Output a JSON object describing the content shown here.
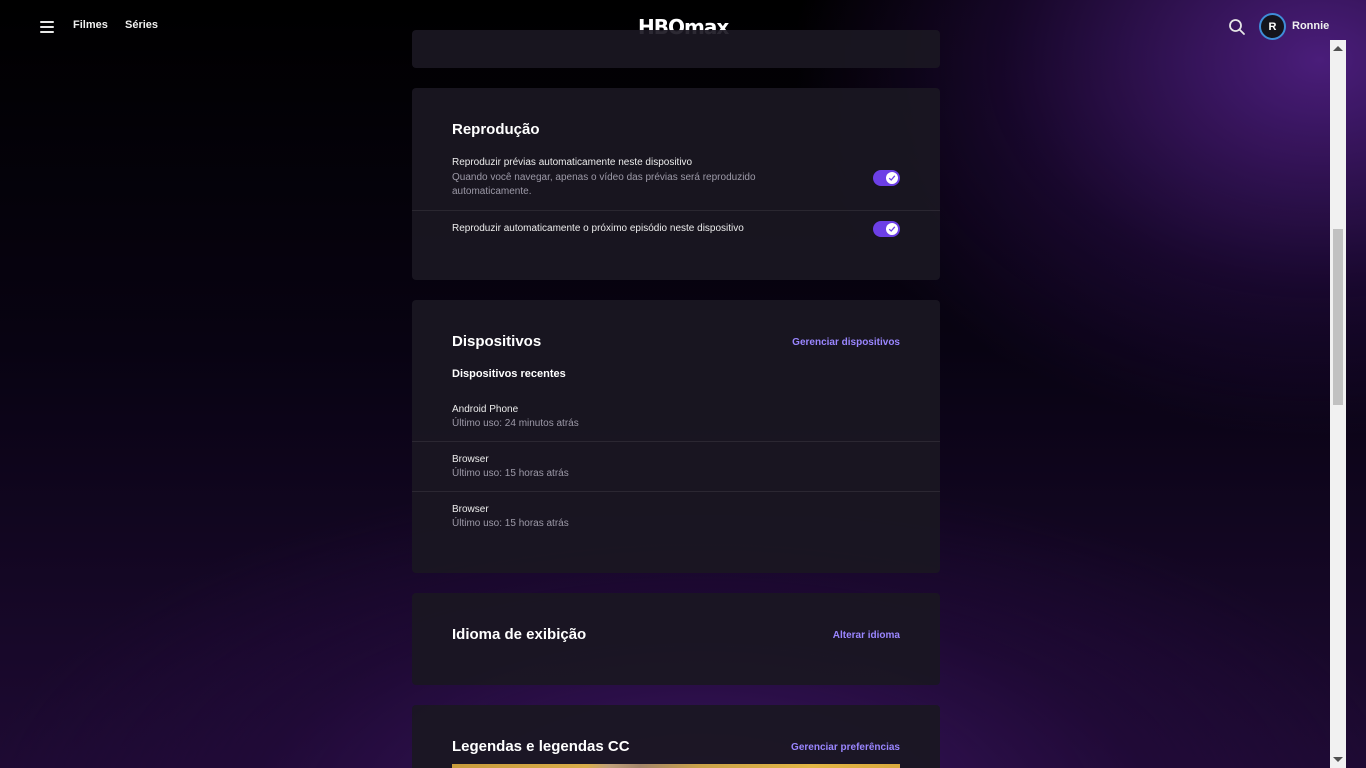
{
  "header": {
    "nav": [
      "Filmes",
      "Séries"
    ],
    "logo": "HBOmax",
    "avatar_initial": "R",
    "username": "Ronnie"
  },
  "reproducao": {
    "title": "Reprodução",
    "rows": [
      {
        "title": "Reproduzir prévias automaticamente neste dispositivo",
        "subtitle": "Quando você navegar, apenas o vídeo das prévias será reproduzido automaticamente.",
        "enabled": true
      },
      {
        "title": "Reproduzir automaticamente o próximo episódio neste dispositivo",
        "enabled": true
      }
    ]
  },
  "dispositivos": {
    "title": "Dispositivos",
    "link": "Gerenciar dispositivos",
    "subheading": "Dispositivos recentes",
    "devices": [
      {
        "name": "Android Phone",
        "last_used": "Último uso: 24 minutos atrás"
      },
      {
        "name": "Browser",
        "last_used": "Último uso: 15 horas atrás"
      },
      {
        "name": "Browser",
        "last_used": "Último uso: 15 horas atrás"
      }
    ]
  },
  "idioma": {
    "title": "Idioma de exibição",
    "link": "Alterar idioma"
  },
  "legendas": {
    "title": "Legendas e legendas CC",
    "link": "Gerenciar preferências"
  },
  "colors": {
    "accent": "#6c3fe6",
    "link": "#9a86ff"
  }
}
